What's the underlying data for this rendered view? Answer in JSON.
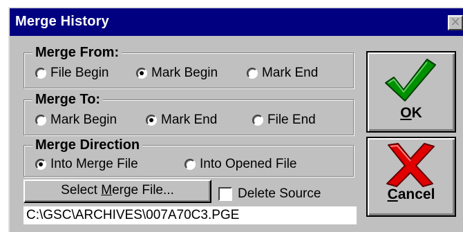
{
  "window": {
    "title": "Merge History",
    "close_glyph": "✕"
  },
  "merge_from": {
    "label": "Merge From:",
    "options": [
      {
        "label": "File Begin",
        "checked": false
      },
      {
        "label": "Mark Begin",
        "checked": true
      },
      {
        "label": "Mark End",
        "checked": false
      }
    ]
  },
  "merge_to": {
    "label": "Merge To:",
    "options": [
      {
        "label": "Mark Begin",
        "checked": false
      },
      {
        "label": "Mark End",
        "checked": true
      },
      {
        "label": "File End",
        "checked": false
      }
    ]
  },
  "merge_direction": {
    "label": "Merge Direction",
    "options": [
      {
        "label": "Into Merge File",
        "checked": true
      },
      {
        "label": "Into Opened File",
        "checked": false
      }
    ]
  },
  "select_file": {
    "label_pre": "Select ",
    "label_mnemonic": "M",
    "label_post": "erge File..."
  },
  "delete_source": {
    "label": "Delete Source",
    "checked": false
  },
  "path_field": {
    "value": "C:\\GSC\\ARCHIVES\\007A70C3.PGE"
  },
  "ok_button": {
    "label_mnemonic": "O",
    "label_post": "K",
    "icon": "green-checkmark-icon",
    "icon_color": "#009000"
  },
  "cancel_button": {
    "label_mnemonic": "C",
    "label_post": "ancel",
    "icon": "red-x-icon",
    "icon_color": "#e00000"
  },
  "colors": {
    "title_bar": "#000080",
    "face": "#c0c0c0"
  }
}
